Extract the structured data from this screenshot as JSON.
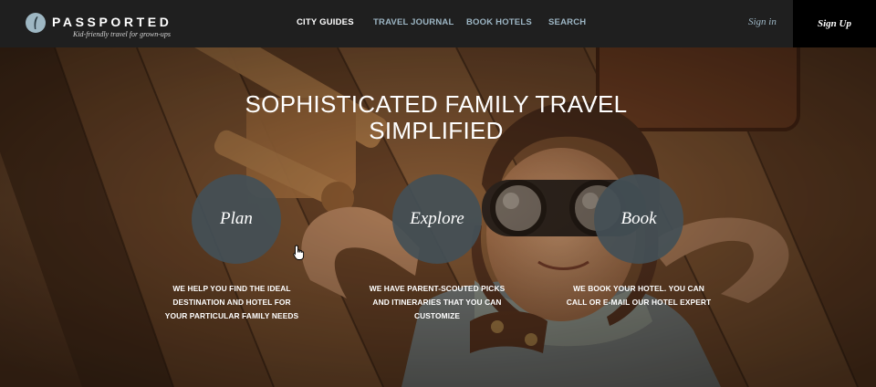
{
  "brand": {
    "name": "PASSPORTED",
    "tagline": "Kid-friendly travel for grown-ups",
    "mark_color": "#9eb7c3"
  },
  "nav": {
    "items": [
      {
        "label": "CITY GUIDES"
      },
      {
        "label": "TRAVEL JOURNAL"
      },
      {
        "label": "BOOK HOTELS"
      },
      {
        "label": "SEARCH"
      }
    ]
  },
  "account": {
    "sign_in": "Sign in",
    "sign_up": "Sign Up"
  },
  "hero": {
    "title_line1": "SOPHISTICATED FAMILY TRAVEL",
    "title_line2": "SIMPLIFIED",
    "features": [
      {
        "label": "Plan",
        "lines": [
          "WE HELP YOU FIND THE IDEAL",
          "DESTINATION AND HOTEL FOR",
          "YOUR PARTICULAR FAMILY NEEDS"
        ]
      },
      {
        "label": "Explore",
        "lines": [
          "WE HAVE PARENT-SCOUTED PICKS",
          "AND ITINERARIES THAT YOU CAN",
          "CUSTOMIZE"
        ]
      },
      {
        "label": "Book",
        "lines": [
          "WE BOOK YOUR HOTEL. YOU CAN",
          "CALL OR E-MAIL OUR HOTEL EXPERT"
        ]
      }
    ]
  },
  "colors": {
    "topbar": "#1f1f1f",
    "signup_bg": "#000000",
    "accent": "#9db6c4",
    "circle": "#445056"
  }
}
